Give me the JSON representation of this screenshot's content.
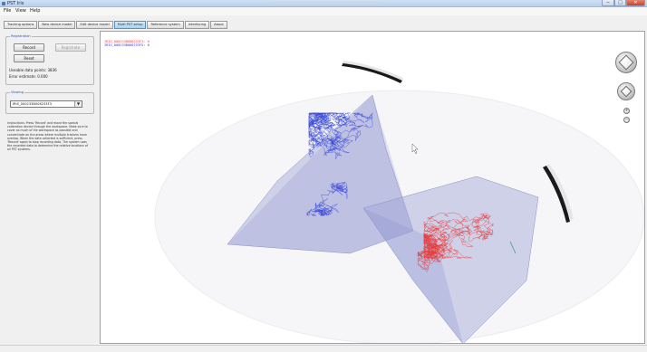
{
  "window": {
    "title": "PST Iris",
    "minimize_glyph": "─",
    "maximize_glyph": "□",
    "close_glyph": "✕"
  },
  "menu": [
    "File",
    "View",
    "Help"
  ],
  "tabs": [
    {
      "label": "Tracking options",
      "active": false
    },
    {
      "label": "New device model",
      "active": false
    },
    {
      "label": "Edit device model",
      "active": false
    },
    {
      "label": "Multi PST setup",
      "active": true
    },
    {
      "label": "Reference system",
      "active": false
    },
    {
      "label": "Interfacing",
      "active": false
    },
    {
      "label": "About",
      "active": false
    }
  ],
  "registration": {
    "title": "Registration",
    "record_label": "Record",
    "register_label": "Registrate",
    "reset_label": "Reset",
    "usable_points": "Useable data points: 3836",
    "error_estimate": "Error estimate: 0.000"
  },
  "viewing": {
    "title": "Viewing",
    "selected_device": "IRIS_000233B006233F3"
  },
  "instructions": "Instructions: Press 'Record' and move the special calibration device through the workspace. Make sure to cover as much of the workspace as possible and concentrate on the areas where multiple trackers have overlap. When the data collected is sufficient, press 'Record' again to stop recording data. The system uses the recorded data to determine the relative locations of all PST systems.",
  "viewport": {
    "device_label_1": "IRIS_000233B006233F3: 0",
    "device_label_2": "IRIS_000233B006233F5: 0",
    "zoom_in_glyph": "+",
    "zoom_out_glyph": "−"
  },
  "colors": {
    "tracker_1_trail": "#3a4ad8",
    "tracker_2_trail": "#e53b3b",
    "frustum_fill": "#9fa3d8",
    "accent_tab": "#a9d3f1"
  }
}
